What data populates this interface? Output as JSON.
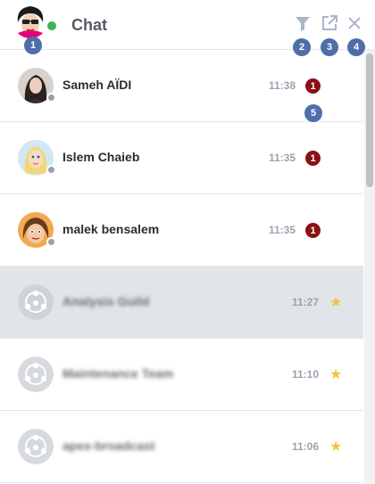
{
  "header": {
    "title": "Chat",
    "icons": [
      "filter-icon",
      "popout-icon",
      "close-icon"
    ],
    "markers": [
      "1",
      "2",
      "3",
      "4",
      "5"
    ]
  },
  "colors": {
    "online": "#3fb34f",
    "unread_badge": "#8b0f14",
    "marker": "#4f6ea8",
    "star": "#f2c43d",
    "selected_row": "#e1e5ea"
  },
  "conversations": [
    {
      "name": "Sameh AÏDI",
      "time": "11:38",
      "unread": "1"
    },
    {
      "name": "Islem Chaieb",
      "time": "11:35",
      "unread": "1"
    },
    {
      "name": "malek bensalem",
      "time": "11:35",
      "unread": "1"
    },
    {
      "name": "Analysis Guild",
      "time": "11:27",
      "starred": true
    },
    {
      "name": "Maintenance Team",
      "time": "11:10",
      "starred": true
    },
    {
      "name": "apex-broadcast",
      "time": "11:06",
      "starred": true
    }
  ]
}
